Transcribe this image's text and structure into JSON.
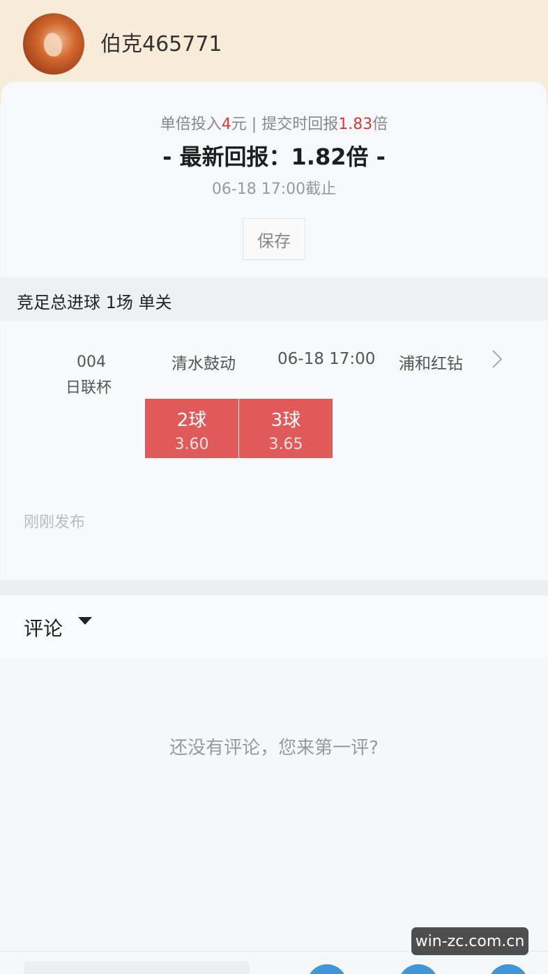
{
  "header": {
    "username": "伯克465771"
  },
  "summary": {
    "bet_prefix": "单倍投入",
    "bet_amount": "4",
    "bet_unit_sep": "元 | 提交时回报",
    "submit_return": "1.83",
    "return_unit": "倍",
    "latest_return": "- 最新回报：1.82倍 -",
    "deadline": "06-18 17:00截止",
    "save_label": "保存"
  },
  "section": {
    "title": "竞足总进球 1场 单关"
  },
  "match": {
    "number": "004",
    "league": "日联杯",
    "home_team": "清水鼓动",
    "time": "06-18 17:00",
    "away_team": "浦和红钻",
    "options": [
      {
        "label": "2球",
        "odds": "3.60"
      },
      {
        "label": "3球",
        "odds": "3.65"
      }
    ]
  },
  "published": "刚刚发布",
  "comments": {
    "label": "评论",
    "empty_text": "还没有评论，您来第一评?"
  },
  "watermark": "win-zc.com.cn",
  "colors": {
    "accent_red": "#e15a5a",
    "header_bg": "#f6ecd8",
    "button_blue": "#3f96d8"
  }
}
